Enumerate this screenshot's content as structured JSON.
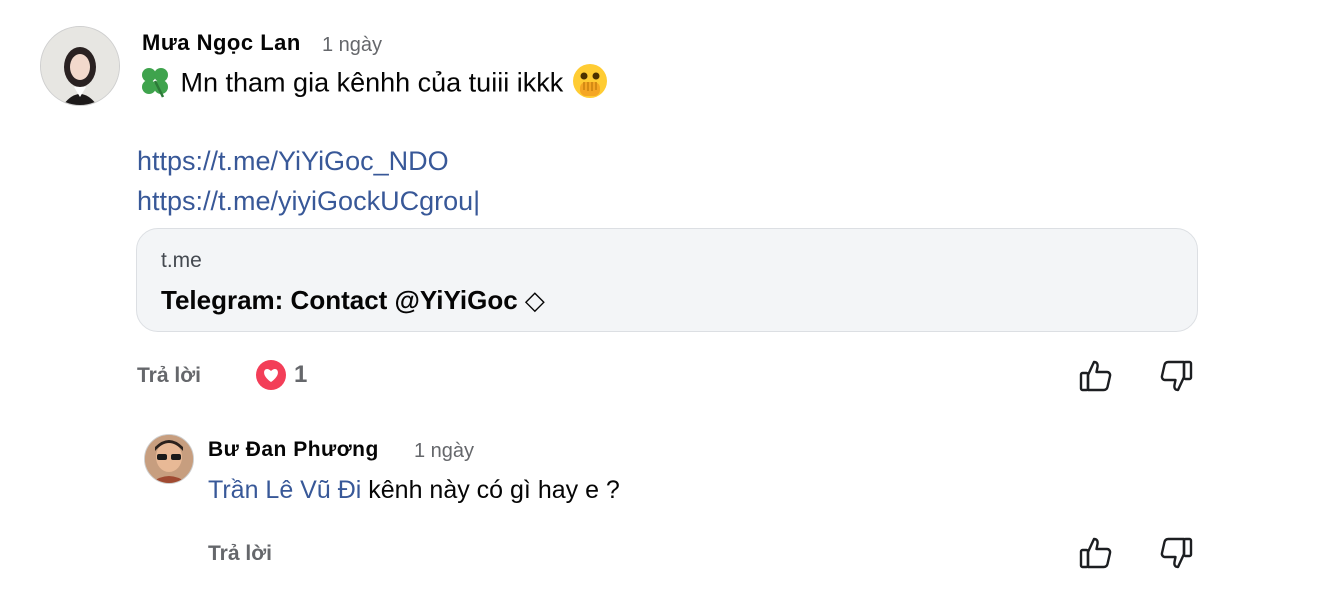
{
  "comment": {
    "author": "Mưa Ngọc Lan",
    "time": "1 ngày",
    "text_prefix_icon": "four-leaf-clover-icon",
    "text": "Mn tham gia kênhh của tuiii ikkk",
    "text_suffix_icon": "face-with-open-eyes-and-hand-over-mouth-icon",
    "links": [
      "https://t.me/YiYiGoc_NDO",
      "https://t.me/yiyiGockUCgrou|"
    ],
    "preview": {
      "domain": "t.me",
      "title": "Telegram: Contact @YiYiGoc  ◇"
    },
    "reply_label": "Trả lời",
    "reaction_icon": "heart-reaction-icon",
    "reaction_count": "1"
  },
  "reply": {
    "author": "Bư Đan Phương",
    "time": "1 ngày",
    "mention": "Trần Lê Vũ Đi",
    "text": " kênh này có gì hay e ?",
    "reply_label": "Trả lời"
  },
  "colors": {
    "link": "#385898",
    "heart": "#f33e58",
    "secondary_text": "#65676b",
    "card_bg": "#f3f5f7"
  }
}
